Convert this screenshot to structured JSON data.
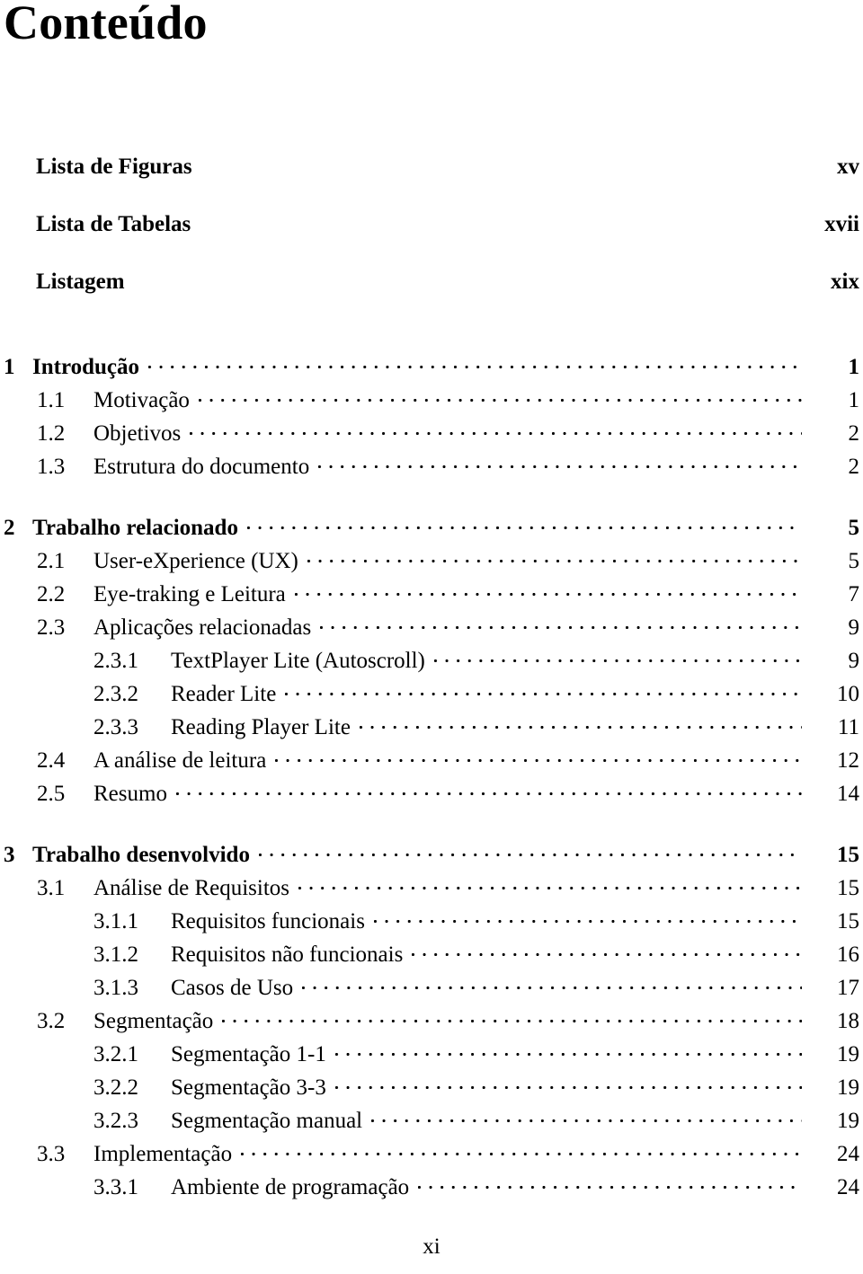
{
  "document": {
    "title": "Conteúdo",
    "folio": "xi"
  },
  "toc": {
    "entries": [
      {
        "level": 0,
        "kind": "front",
        "number": "",
        "title": "Lista de Figuras",
        "page": "xv"
      },
      {
        "level": 0,
        "kind": "front",
        "number": "",
        "title": "Lista de Tabelas",
        "page": "xvii"
      },
      {
        "level": 0,
        "kind": "front",
        "number": "",
        "title": "Listagem",
        "page": "xix"
      },
      {
        "level": 0,
        "kind": "chapter",
        "number": "1",
        "title": "Introdução",
        "page": "1"
      },
      {
        "level": 1,
        "kind": "section",
        "number": "1.1",
        "title": "Motivação",
        "page": "1"
      },
      {
        "level": 1,
        "kind": "section",
        "number": "1.2",
        "title": "Objetivos",
        "page": "2"
      },
      {
        "level": 1,
        "kind": "section",
        "number": "1.3",
        "title": "Estrutura do documento",
        "page": "2"
      },
      {
        "level": 0,
        "kind": "chapter",
        "number": "2",
        "title": "Trabalho relacionado",
        "page": "5"
      },
      {
        "level": 1,
        "kind": "section",
        "number": "2.1",
        "title": "User-eXperience (UX)",
        "page": "5"
      },
      {
        "level": 1,
        "kind": "section",
        "number": "2.2",
        "title": "Eye-traking e Leitura",
        "page": "7"
      },
      {
        "level": 1,
        "kind": "section",
        "number": "2.3",
        "title": "Aplicações relacionadas",
        "page": "9"
      },
      {
        "level": 2,
        "kind": "subsection",
        "number": "2.3.1",
        "title": "TextPlayer Lite (Autoscroll)",
        "page": "9"
      },
      {
        "level": 2,
        "kind": "subsection",
        "number": "2.3.2",
        "title": "Reader Lite",
        "page": "10"
      },
      {
        "level": 2,
        "kind": "subsection",
        "number": "2.3.3",
        "title": "Reading Player Lite",
        "page": "11"
      },
      {
        "level": 1,
        "kind": "section",
        "number": "2.4",
        "title": "A análise de leitura",
        "page": "12"
      },
      {
        "level": 1,
        "kind": "section",
        "number": "2.5",
        "title": "Resumo",
        "page": "14"
      },
      {
        "level": 0,
        "kind": "chapter",
        "number": "3",
        "title": "Trabalho desenvolvido",
        "page": "15"
      },
      {
        "level": 1,
        "kind": "section",
        "number": "3.1",
        "title": "Análise de Requisitos",
        "page": "15"
      },
      {
        "level": 2,
        "kind": "subsection",
        "number": "3.1.1",
        "title": "Requisitos funcionais",
        "page": "15"
      },
      {
        "level": 2,
        "kind": "subsection",
        "number": "3.1.2",
        "title": "Requisitos não funcionais",
        "page": "16"
      },
      {
        "level": 2,
        "kind": "subsection",
        "number": "3.1.3",
        "title": "Casos de Uso",
        "page": "17"
      },
      {
        "level": 1,
        "kind": "section",
        "number": "3.2",
        "title": "Segmentação",
        "page": "18"
      },
      {
        "level": 2,
        "kind": "subsection",
        "number": "3.2.1",
        "title": "Segmentação 1-1",
        "page": "19"
      },
      {
        "level": 2,
        "kind": "subsection",
        "number": "3.2.2",
        "title": "Segmentação 3-3",
        "page": "19"
      },
      {
        "level": 2,
        "kind": "subsection",
        "number": "3.2.3",
        "title": "Segmentação manual",
        "page": "19"
      },
      {
        "level": 1,
        "kind": "section",
        "number": "3.3",
        "title": "Implementação",
        "page": "24"
      },
      {
        "level": 2,
        "kind": "subsection",
        "number": "3.3.1",
        "title": "Ambiente de programação",
        "page": "24"
      }
    ]
  }
}
